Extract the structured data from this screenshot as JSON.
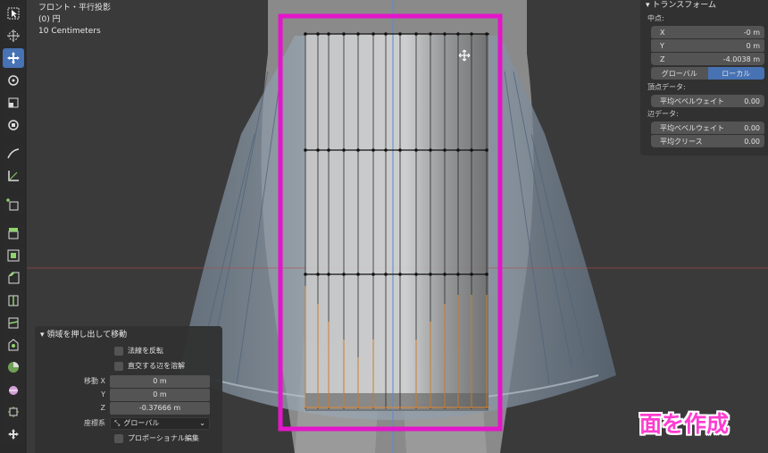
{
  "view_info": {
    "projection": "フロント・平行投影",
    "object": "(0) 円",
    "scale": "10 Centimeters"
  },
  "toolbar": {
    "tools": [
      {
        "icon": "cursor-select-icon",
        "active": false
      },
      {
        "icon": "3d-cursor-icon",
        "active": false
      },
      {
        "icon": "move-icon",
        "active": true
      },
      {
        "icon": "rotate-icon",
        "active": false
      },
      {
        "icon": "scale-icon",
        "active": false
      },
      {
        "icon": "transform-icon",
        "active": false
      },
      {
        "icon": "annotate-icon",
        "active": false
      },
      {
        "icon": "measure-icon",
        "active": false
      },
      {
        "icon": "add-cube-icon",
        "active": false
      },
      {
        "icon": "extrude-region-icon",
        "active": false
      },
      {
        "icon": "inset-faces-icon",
        "active": false
      },
      {
        "icon": "bevel-icon",
        "active": false
      },
      {
        "icon": "loop-cut-icon",
        "active": false
      },
      {
        "icon": "knife-icon",
        "active": false
      },
      {
        "icon": "poly-build-icon",
        "active": false
      },
      {
        "icon": "spin-icon",
        "active": false
      },
      {
        "icon": "smooth-icon",
        "active": false
      },
      {
        "icon": "shrink-fatten-icon",
        "active": false
      },
      {
        "icon": "shear-icon",
        "active": false
      }
    ]
  },
  "transform_panel": {
    "title": "トランスフォーム",
    "median_label": "中点:",
    "x_label": "X",
    "x_value": "-0 m",
    "y_label": "Y",
    "y_value": "0 m",
    "z_label": "Z",
    "z_value": "-4.0038 m",
    "global_label": "グローバル",
    "local_label": "ローカル",
    "vertex_data_label": "頂点データ:",
    "vertex_bevel_label": "平均ベベルウェイト",
    "vertex_bevel_value": "0.00",
    "edge_data_label": "辺データ:",
    "edge_bevel_label": "平均ベベルウェイト",
    "edge_bevel_value": "0.00",
    "crease_label": "平均クリース",
    "crease_value": "0.00"
  },
  "operator_panel": {
    "title": "領域を押し出して移動",
    "flip_normals": "法線を反転",
    "dissolve_orthogonal": "直交する辺を溶解",
    "move_x_label": "移動 X",
    "move_x_value": "0 m",
    "move_y_label": "Y",
    "move_y_value": "0 m",
    "move_z_label": "Z",
    "move_z_value": "-0.37666 m",
    "orientation_label": "座標系",
    "orientation_value": "グローバル",
    "proportional_edit": "プロポーショナル編集"
  },
  "caption": "面を作成",
  "colors": {
    "highlight_frame": "#e316c9",
    "caption": "#ff3cd0",
    "active_tool": "#4772b3"
  }
}
